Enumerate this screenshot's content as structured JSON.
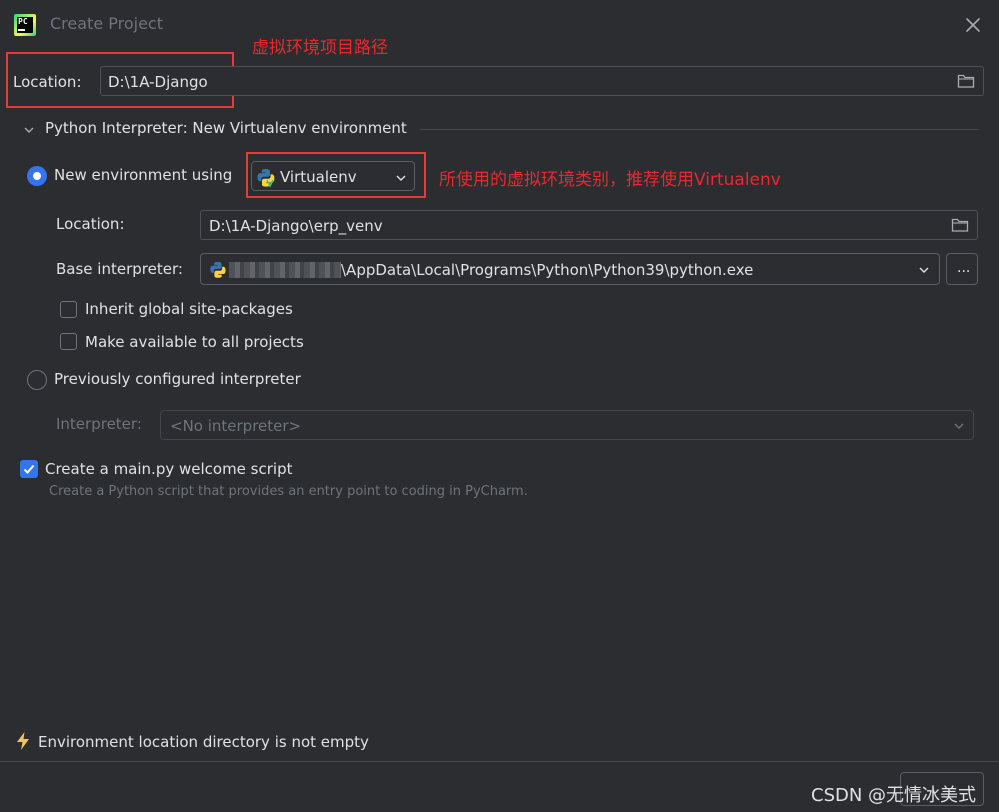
{
  "window": {
    "title": "Create Project",
    "logo_text": "PC"
  },
  "annotations": {
    "project_path": "虚拟环境项目路径",
    "env_type": "所使用的虚拟环境类别，推荐使用Virtualenv"
  },
  "location": {
    "label": "Location:",
    "value": "D:\\1A-Django"
  },
  "interpreter_section": {
    "title": "Python Interpreter: New Virtualenv environment"
  },
  "new_env": {
    "label": "New environment using",
    "type_value": "Virtualenv",
    "location_label": "Location:",
    "location_value": "D:\\1A-Django\\erp_venv",
    "base_label": "Base interpreter:",
    "base_value": "\\AppData\\Local\\Programs\\Python\\Python39\\python.exe",
    "dots_label": "...",
    "inherit_label": "Inherit global site-packages",
    "make_available_label": "Make available to all projects"
  },
  "previous": {
    "label": "Previously configured interpreter",
    "interpreter_label": "Interpreter:",
    "interpreter_value": "<No interpreter>"
  },
  "welcome": {
    "label": "Create a main.py welcome script",
    "hint": "Create a Python script that provides an entry point to coding in PyCharm."
  },
  "warning": {
    "text": "Environment location directory is not empty"
  },
  "watermark": {
    "text": "CSDN @无情冰美式"
  },
  "colors": {
    "accent": "#3574f0",
    "annotation": "#e8292f",
    "background": "#2b2d30"
  }
}
